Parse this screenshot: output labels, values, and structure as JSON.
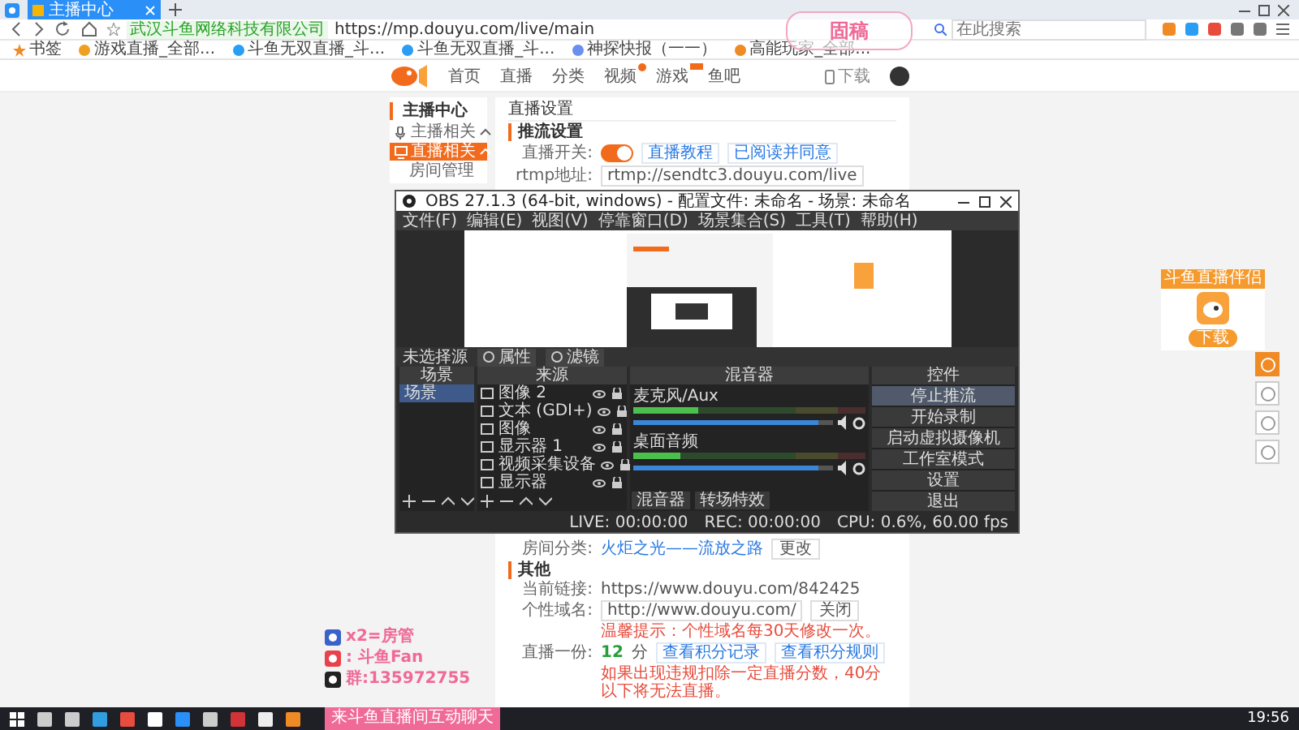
{
  "browser": {
    "tab": "主播中心",
    "site_name": "武汉斗鱼网络科技有限公司",
    "url": "https://mp.douyu.com/live/main",
    "search_placeholder": "在此搜索",
    "bookmarks": [
      "书签",
      "游戏直播_全部...",
      "斗鱼无双直播_斗...",
      "斗鱼无双直播_斗...",
      "神探快报（一一）",
      "高能玩家_全部..."
    ]
  },
  "site": {
    "nav": [
      {
        "label": "首页",
        "kind": "plain"
      },
      {
        "label": "直播",
        "kind": "plain"
      },
      {
        "label": "分类",
        "kind": "plain"
      },
      {
        "label": "视频",
        "kind": "dot"
      },
      {
        "label": "游戏",
        "kind": "tag"
      },
      {
        "label": "鱼吧",
        "kind": "plain"
      }
    ],
    "download": "下载"
  },
  "sidebar": {
    "title": "主播中心",
    "items": [
      {
        "label": "主播相关",
        "selected": false
      },
      {
        "label": "直播相关",
        "selected": true,
        "children": [
          {
            "label": "房间管理",
            "selected": false
          }
        ]
      }
    ]
  },
  "content": {
    "title": "直播设置",
    "section": "推流设置",
    "switch": {
      "label": "直播开关:",
      "on": true
    },
    "links": [
      "直播教程",
      "已阅读并同意"
    ],
    "rtmp_label": "rtmp地址:",
    "rtmp": "rtmp://sendtc3.douyu.com/live",
    "category": {
      "label": "房间分类:",
      "value": "火炬之光——流放之路",
      "button": "更改"
    },
    "other": {
      "title": "其他",
      "current_label": "当前链接:",
      "current": "https://www.douyu.com/842425",
      "custom_label": "个性域名:",
      "custom_value": "http://www.douyu.com/",
      "custom_button": "关闭",
      "custom_hint": "温馨提示：个性域名每30天修改一次。",
      "score_label": "直播一份:",
      "score": "12",
      "score_unit": "分",
      "score_links": [
        "查看积分记录",
        "查看积分规则"
      ],
      "score_note": "如果出现违规扣除一定直播分数，40分以下将无法直播。"
    }
  },
  "obs": {
    "title": "OBS 27.1.3 (64-bit, windows) - 配置文件: 未命名 - 场景: 未命名",
    "menu": [
      "文件(F)",
      "编辑(E)",
      "视图(V)",
      "停靠窗口(D)",
      "场景集合(S)",
      "工具(T)",
      "帮助(H)"
    ],
    "no_source": "未选择源",
    "props": [
      "属性",
      "滤镜"
    ],
    "docks": [
      "场景",
      "来源",
      "混音器",
      "控件"
    ],
    "scenes": [
      {
        "label": "场景",
        "selected": true
      }
    ],
    "sources": [
      "图像 2",
      "文本 (GDI+)",
      "图像",
      "显示器 1",
      "视频采集设备",
      "显示器"
    ],
    "mixer": [
      {
        "name": "麦克风/Aux",
        "meter": {
          "level": 0.28
        },
        "volume": {
          "level": 0.93
        }
      },
      {
        "name": "桌面音频",
        "meter": {
          "level": 0.2
        },
        "volume": {
          "level": 0.93
        }
      }
    ],
    "mixer_tabs": [
      "混音器",
      "转场特效"
    ],
    "controls": [
      {
        "label": "停止推流",
        "selected": true
      },
      {
        "label": "开始录制",
        "selected": false
      },
      {
        "label": "启动虚拟摄像机",
        "selected": false
      },
      {
        "label": "工作室模式",
        "selected": false
      },
      {
        "label": "设置",
        "selected": false
      },
      {
        "label": "退出",
        "selected": false
      }
    ],
    "status": [
      "LIVE: 00:00:00",
      "REC: 00:00:00",
      "CPU: 0.6%, 60.00 fps"
    ]
  },
  "overlay": {
    "logo": "固稿",
    "lines": [
      {
        "kind": "fan",
        "text": "x2=房管"
      },
      {
        "kind": "badge",
        "text": ": 斗鱼Fan"
      },
      {
        "kind": "qq",
        "text": "群:135972755"
      }
    ],
    "banner": "来斗鱼直播间互动聊天",
    "promo": {
      "title": "斗鱼直播伴侣",
      "button": "下载"
    }
  },
  "taskbar": {
    "clock": "19:56"
  }
}
